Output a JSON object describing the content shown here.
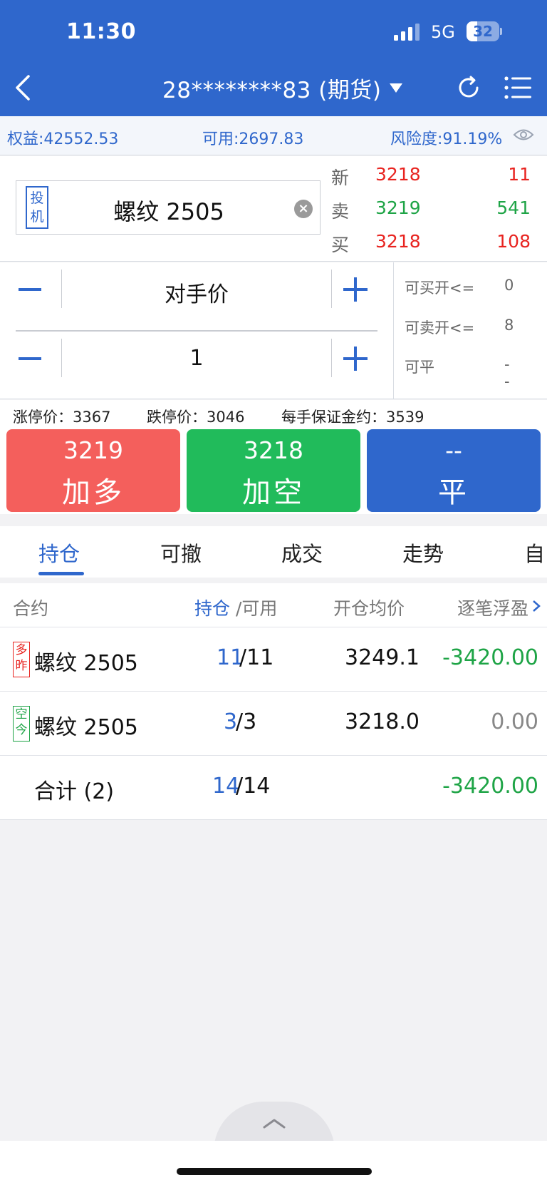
{
  "status_bar": {
    "time": "11:30",
    "network": "5G",
    "battery": "32"
  },
  "header": {
    "account": "28********83 (期货)"
  },
  "account_info": {
    "equity": "权益:42552.53",
    "available": "可用:2697.83",
    "risk": "风险度:91.19%"
  },
  "contract": {
    "tag": "投机",
    "name": "螺纹 2505"
  },
  "quote": [
    {
      "label": "新",
      "price": "3218",
      "volume": "11"
    },
    {
      "label": "卖",
      "price": "3219",
      "volume": "541"
    },
    {
      "label": "买",
      "price": "3218",
      "volume": "108"
    }
  ],
  "order": {
    "price_mode": "对手价",
    "quantity": "1"
  },
  "limits_side": [
    {
      "label": "可买开<=",
      "value": "0"
    },
    {
      "label": "可卖开<=",
      "value": "8"
    },
    {
      "label": "可平",
      "value": "--"
    }
  ],
  "limits": {
    "up": "涨停价：3367",
    "down": "跌停价：3046",
    "margin": "每手保证金约：3539"
  },
  "actions": [
    {
      "price": "3219",
      "label": "加多"
    },
    {
      "price": "3218",
      "label": "加空"
    },
    {
      "price": "--",
      "label": "平"
    }
  ],
  "tabs": [
    "持仓",
    "可撤",
    "成交",
    "走势",
    "自"
  ],
  "table": {
    "headers": {
      "contract": "合约",
      "position": "持仓",
      "slash_available": "/可用",
      "avg_price": "开仓均价",
      "pnl": "逐笔浮盈"
    },
    "rows": [
      {
        "tag1": "多",
        "tag2": "昨",
        "name": "螺纹 2505",
        "pos": "11",
        "avail": "/11",
        "price": "3249.1",
        "pnl": "-3420.00"
      },
      {
        "tag1": "空",
        "tag2": "今",
        "name": "螺纹 2505",
        "pos": "3",
        "avail": "/3",
        "price": "3218.0",
        "pnl": "0.00"
      }
    ],
    "total": {
      "label": "合计 (2)",
      "pos": "14",
      "avail": "/14",
      "pnl": "-3420.00"
    }
  },
  "colors": {
    "brand": "#2f67cc",
    "up": "#e8231f",
    "down": "#1ea446"
  }
}
